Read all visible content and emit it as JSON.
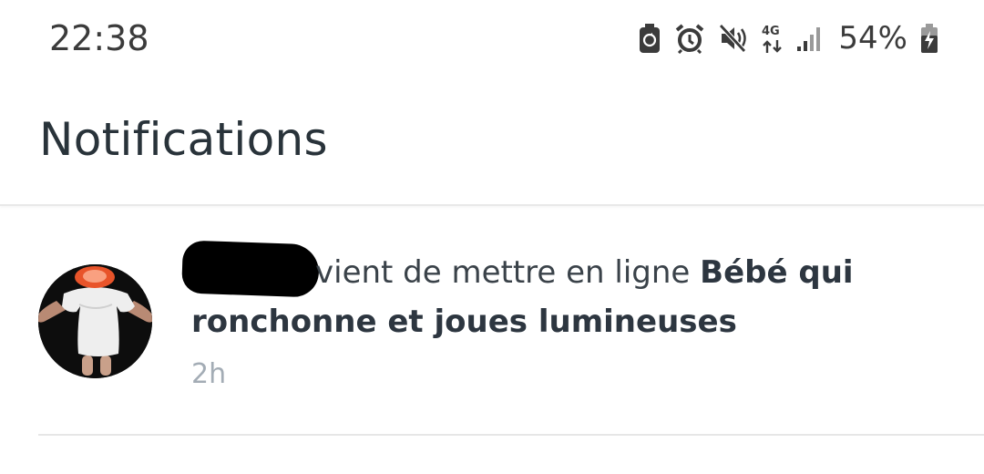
{
  "status_bar": {
    "time": "22:38",
    "icons": [
      "battery-saver-icon",
      "alarm-icon",
      "mute-icon",
      "network-4g-icon",
      "signal-icon",
      "charging-battery-icon"
    ],
    "battery_percent": "54%"
  },
  "header": {
    "title": "Notifications"
  },
  "notifications": [
    {
      "avatar": "baby-doll-avatar",
      "sender_redacted": true,
      "action_text": "vient de mettre en ligne ",
      "item_title": "Bébé qui ronchonne et joues lumineuses",
      "time_ago": "2h"
    }
  ]
}
